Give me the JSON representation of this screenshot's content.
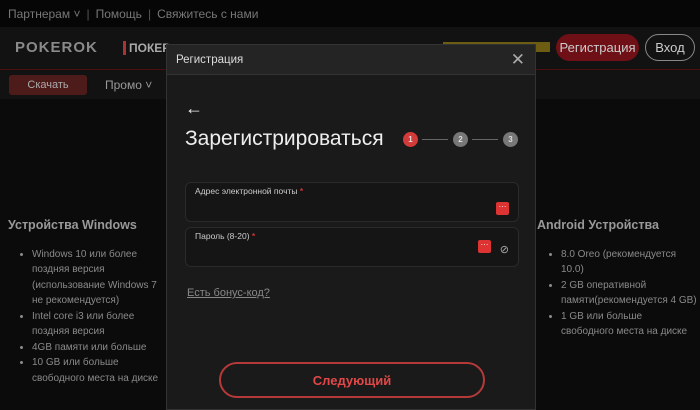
{
  "topbar": {
    "partners": "Партнерам ˅",
    "help": "Помощь",
    "contact": "Свяжитесь с нами"
  },
  "header": {
    "logo": "POKEROK",
    "poker_link": "ПОКЕР",
    "register": "Регистрация",
    "login": "Вход"
  },
  "nav": {
    "download": "Скачать",
    "promo": "Промо ˅"
  },
  "windows": {
    "title": "Устройства Windows",
    "items": [
      "Windows 10 или более поздняя версия (использование Windows 7 не рекомендуется)",
      "Intel core i3 или более поздняя версия",
      "4GB памяти или больше",
      "10 GB или больше свободного места на диске"
    ]
  },
  "android": {
    "title": "Android Устройства",
    "items": [
      "8.0 Oreo (рекомендуется 10.0)",
      "2 GB оперативной памяти(рекомендуется 4 GB)",
      "1 GB или больше свободного места на диске"
    ]
  },
  "modal": {
    "title": "Регистрация",
    "heading": "Зарегистрироваться",
    "steps": [
      "1",
      "2",
      "3"
    ],
    "current_step": 1,
    "email_label": "Адрес электронной почты",
    "password_label": "Пароль (8-20)",
    "required": "*",
    "bonus": "Есть бонус-код?",
    "next": "Следующий",
    "accent": "#d33a3a"
  }
}
